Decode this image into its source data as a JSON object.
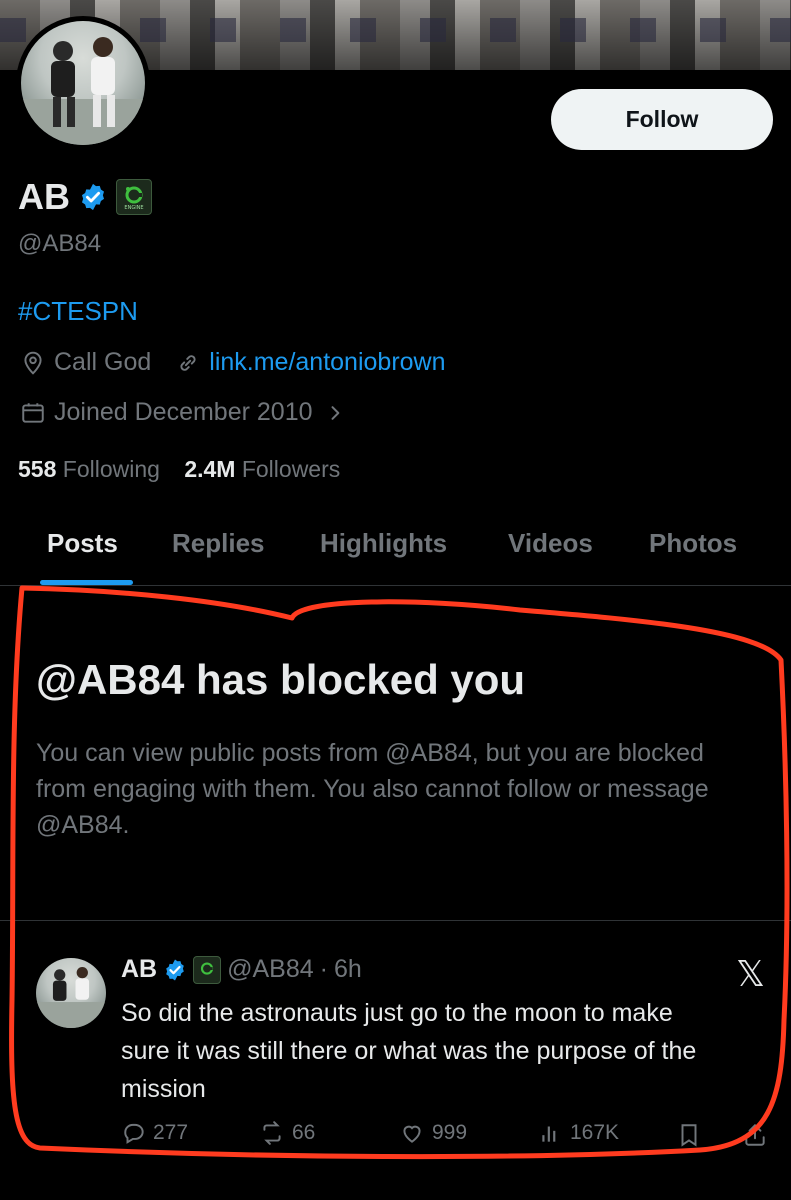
{
  "profile": {
    "name": "AB",
    "handle": "@AB84",
    "bio_hashtag": "#CTESPN",
    "location": "Call God",
    "website": "link.me/antoniobrown",
    "joined": "Joined December 2010",
    "following_count": "558",
    "following_label": "Following",
    "followers_count": "2.4M",
    "followers_label": "Followers",
    "follow_label": "Follow",
    "badge_text": "ENGINE"
  },
  "tabs": [
    {
      "label": "Posts",
      "active": true
    },
    {
      "label": "Replies",
      "active": false
    },
    {
      "label": "Highlights",
      "active": false
    },
    {
      "label": "Videos",
      "active": false
    },
    {
      "label": "Photos",
      "active": false
    }
  ],
  "blocked": {
    "title": "@AB84 has blocked you",
    "message": "You can view public posts from @AB84, but you are blocked from engaging with them. You also cannot follow or message @AB84."
  },
  "post": {
    "name": "AB",
    "handle": "@AB84",
    "separator": "·",
    "time": "6h",
    "text": "So did the astronauts just go to the moon to make sure it was still there or what was the purpose of the mission",
    "replies": "277",
    "reposts": "66",
    "likes": "999",
    "views": "167K"
  },
  "icons": {
    "verified": "verified-badge-icon",
    "location": "location-pin-icon",
    "link": "link-icon",
    "calendar": "calendar-icon",
    "chevron": "chevron-right-icon",
    "x_logo": "x-logo-icon"
  },
  "colors": {
    "background": "#000000",
    "accent": "#1d9bf0",
    "text_primary": "#e7e9ea",
    "text_secondary": "#71767b",
    "annotation": "#ff3b1f"
  }
}
